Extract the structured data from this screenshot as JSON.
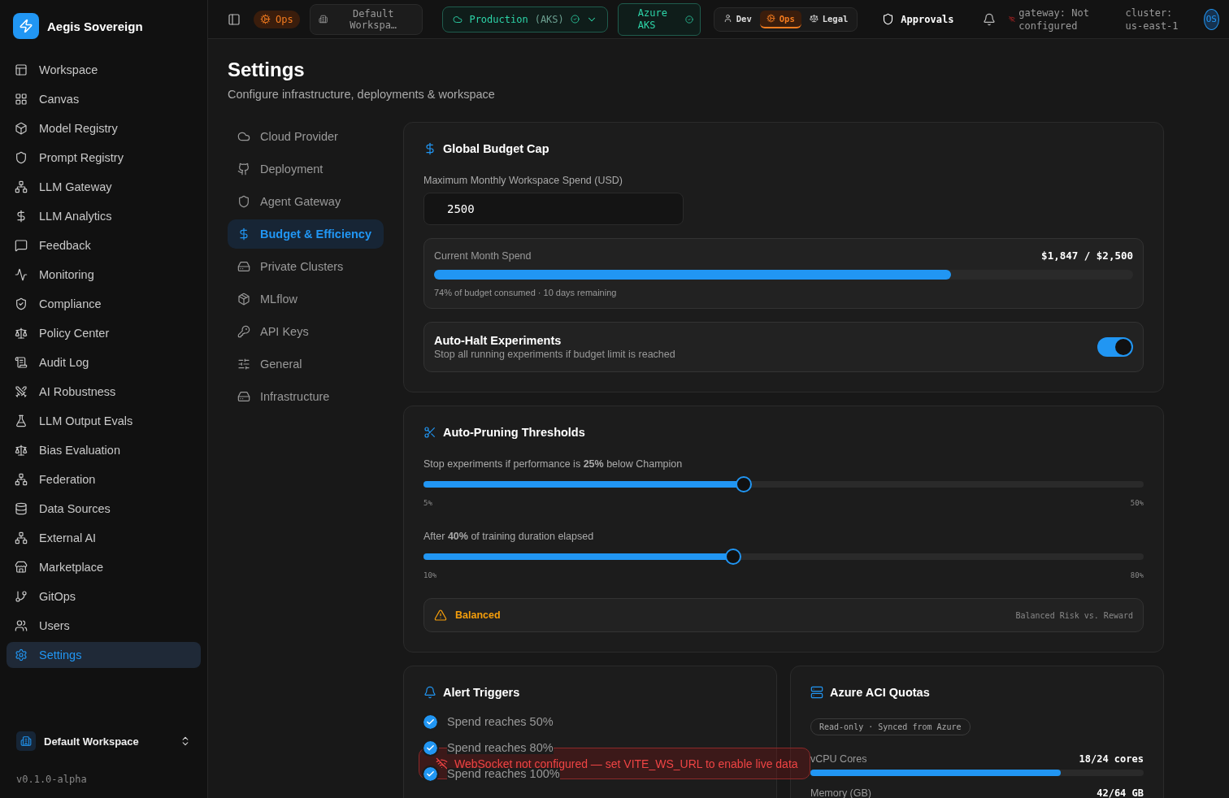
{
  "app": {
    "name": "Aegis Sovereign"
  },
  "sidebar": {
    "items": [
      {
        "label": "Workspace",
        "selected": false
      },
      {
        "label": "Canvas",
        "selected": false
      },
      {
        "label": "Model Registry",
        "selected": false
      },
      {
        "label": "Prompt Registry",
        "selected": false
      },
      {
        "label": "LLM Gateway",
        "selected": false
      },
      {
        "label": "LLM Analytics",
        "selected": false
      },
      {
        "label": "Feedback",
        "selected": false
      },
      {
        "label": "Monitoring",
        "selected": false
      },
      {
        "label": "Compliance",
        "selected": false
      },
      {
        "label": "Policy Center",
        "selected": false
      },
      {
        "label": "Audit Log",
        "selected": false
      },
      {
        "label": "AI Robustness",
        "selected": false
      },
      {
        "label": "LLM Output Evals",
        "selected": false
      },
      {
        "label": "Bias Evaluation",
        "selected": false
      },
      {
        "label": "Federation",
        "selected": false
      },
      {
        "label": "Data Sources",
        "selected": false
      },
      {
        "label": "External AI",
        "selected": false
      },
      {
        "label": "Marketplace",
        "selected": false
      },
      {
        "label": "GitOps",
        "selected": false
      },
      {
        "label": "Users",
        "selected": false
      },
      {
        "label": "Settings",
        "selected": true
      }
    ],
    "workspace": "Default Workspace",
    "version": "v0.1.0-alpha"
  },
  "topbar": {
    "mode_badge": "Ops",
    "workspace_chip": "Default Workspa…",
    "environment": {
      "name": "Production",
      "cluster": "(AKS)"
    },
    "provider_chip": "Azure AKS",
    "roles": [
      {
        "label": "Dev",
        "selected": false
      },
      {
        "label": "Ops",
        "selected": true
      },
      {
        "label": "Legal",
        "selected": false
      }
    ],
    "approvals": "Approvals",
    "gateway": "gateway: Not configured",
    "cluster": "cluster: us-east-1",
    "avatar": "OS"
  },
  "page": {
    "title": "Settings",
    "subtitle": "Configure infrastructure, deployments & workspace"
  },
  "settings_nav": [
    {
      "label": "Cloud Provider",
      "selected": false
    },
    {
      "label": "Deployment",
      "selected": false
    },
    {
      "label": "Agent Gateway",
      "selected": false
    },
    {
      "label": "Budget & Efficiency",
      "selected": true
    },
    {
      "label": "Private Clusters",
      "selected": false
    },
    {
      "label": "MLflow",
      "selected": false
    },
    {
      "label": "API Keys",
      "selected": false
    },
    {
      "label": "General",
      "selected": false
    },
    {
      "label": "Infrastructure",
      "selected": false
    }
  ],
  "budget_cap": {
    "title": "Global Budget Cap",
    "field_label": "Maximum Monthly Workspace Spend (USD)",
    "value": "2500",
    "spend": {
      "label": "Current Month Spend",
      "amount": "$1,847 / $2,500",
      "level": 0.74,
      "note": "74% of budget consumed · 10 days remaining"
    },
    "auto_halt": {
      "title": "Auto-Halt Experiments",
      "description": "Stop all running experiments if budget limit is reached",
      "on": true
    }
  },
  "pruning": {
    "title": "Auto-Pruning Thresholds",
    "sliders": [
      {
        "label": "Stop experiments if performance is **25%** below Champion",
        "level": 0.445,
        "min": "5%",
        "max": "50%"
      },
      {
        "label": "After **40%** of training duration elapsed",
        "level": 0.43,
        "min": "10%",
        "max": "80%"
      }
    ],
    "profile": {
      "name": "Balanced",
      "description": "Balanced Risk vs. Reward"
    }
  },
  "alerts": {
    "title": "Alert Triggers",
    "items": [
      {
        "label": "Spend reaches 50%",
        "checked": true
      },
      {
        "label": "Spend reaches 80%",
        "checked": true
      },
      {
        "label": "Spend reaches 100%",
        "checked": true
      }
    ]
  },
  "quotas": {
    "title": "Azure ACI Quotas",
    "badge": "Read-only · Synced from Azure",
    "items": [
      {
        "label": "vCPU Cores",
        "value": "18/24 cores",
        "level": 0.75
      },
      {
        "label": "Memory (GB)",
        "value": "42/64 GB"
      }
    ]
  },
  "toast": {
    "message": "WebSocket not configured — set VITE_WS_URL to enable live data"
  }
}
